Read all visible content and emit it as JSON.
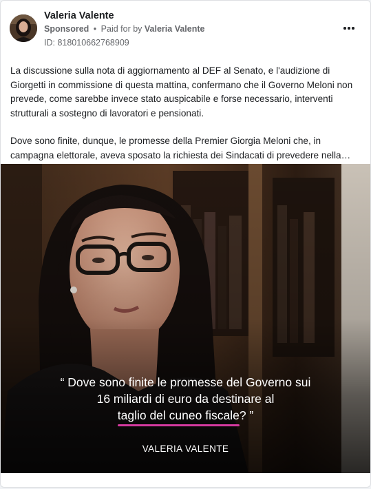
{
  "post": {
    "author_name": "Valeria Valente",
    "sponsored_label": "Sponsored",
    "separator": "•",
    "paid_for_label": "Paid for by",
    "paid_for_name": "Valeria Valente",
    "ad_id": "ID: 818010662768909",
    "paragraph_1": "La discussione sulla nota di aggiornamento al DEF al Senato, e l'audizione di Giorgetti in commissione di questa mattina, confermano che il Governo Meloni non prevede, come sarebbe invece stato auspicabile e forse necessario, interventi strutturali a sostegno di lavoratori e pensionati.",
    "paragraph_2": "Dove sono finite, dunque, le promesse della Premier Giorgia Meloni che, in campagna elettorale, aveva sposato la richiesta dei Sindacati di prevedere nella…"
  },
  "media": {
    "quote_line_1": "“ Dove sono finite le promesse del Governo sui",
    "quote_line_2": "16 miliardi di euro da destinare al",
    "quote_line_3_highlight": "taglio del cuneo fiscale",
    "quote_line_3_end": "? ”",
    "signature": "VALERIA VALENTE",
    "accent_color": "#d63aa0"
  },
  "icons": {
    "more": "more-options-icon",
    "avatar": "avatar-photo"
  }
}
